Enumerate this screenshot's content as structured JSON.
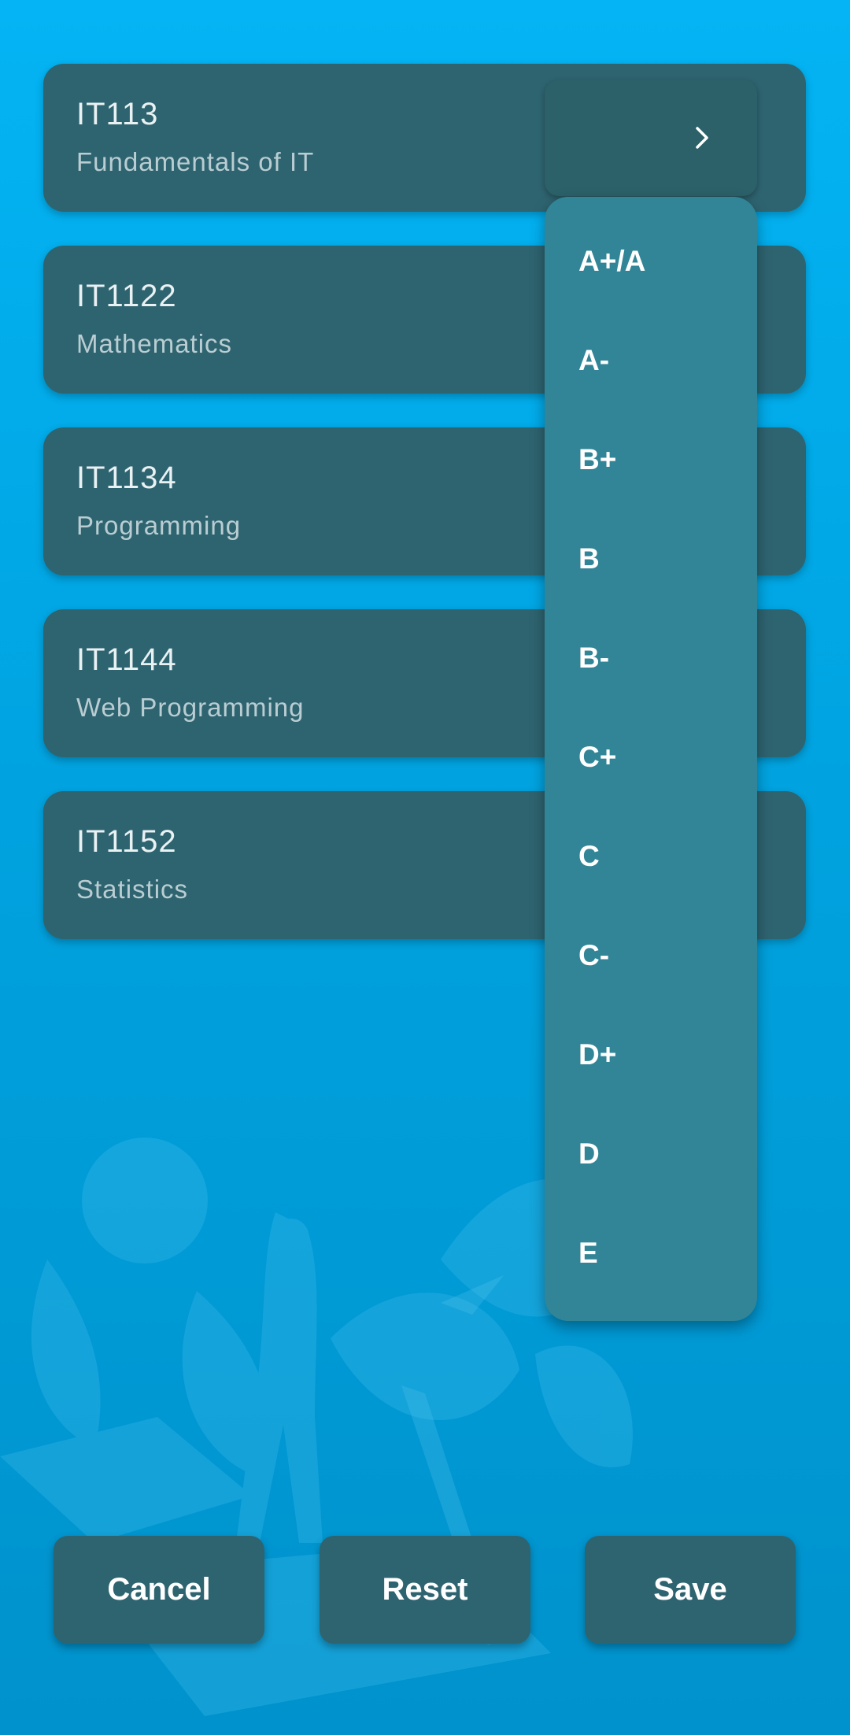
{
  "courses": [
    {
      "code": "IT113",
      "name": "Fundamentals of IT"
    },
    {
      "code": "IT1122",
      "name": "Mathematics"
    },
    {
      "code": "IT1134",
      "name": "Programming"
    },
    {
      "code": "IT1144",
      "name": "Web Programming"
    },
    {
      "code": "IT1152",
      "name": "Statistics"
    }
  ],
  "grade_dropdown": {
    "selected": "",
    "options": [
      "A+/A",
      "A-",
      "B+",
      "B",
      "B-",
      "C+",
      "C",
      "C-",
      "D+",
      "D",
      "E"
    ]
  },
  "actions": {
    "cancel_label": "Cancel",
    "reset_label": "Reset",
    "save_label": "Save"
  },
  "colors": {
    "background": "#04b4f4",
    "card": "#2e6470",
    "menu": "#318597",
    "text": "#ffffff"
  },
  "icons": {
    "dropdown": "chevron-right-icon"
  }
}
